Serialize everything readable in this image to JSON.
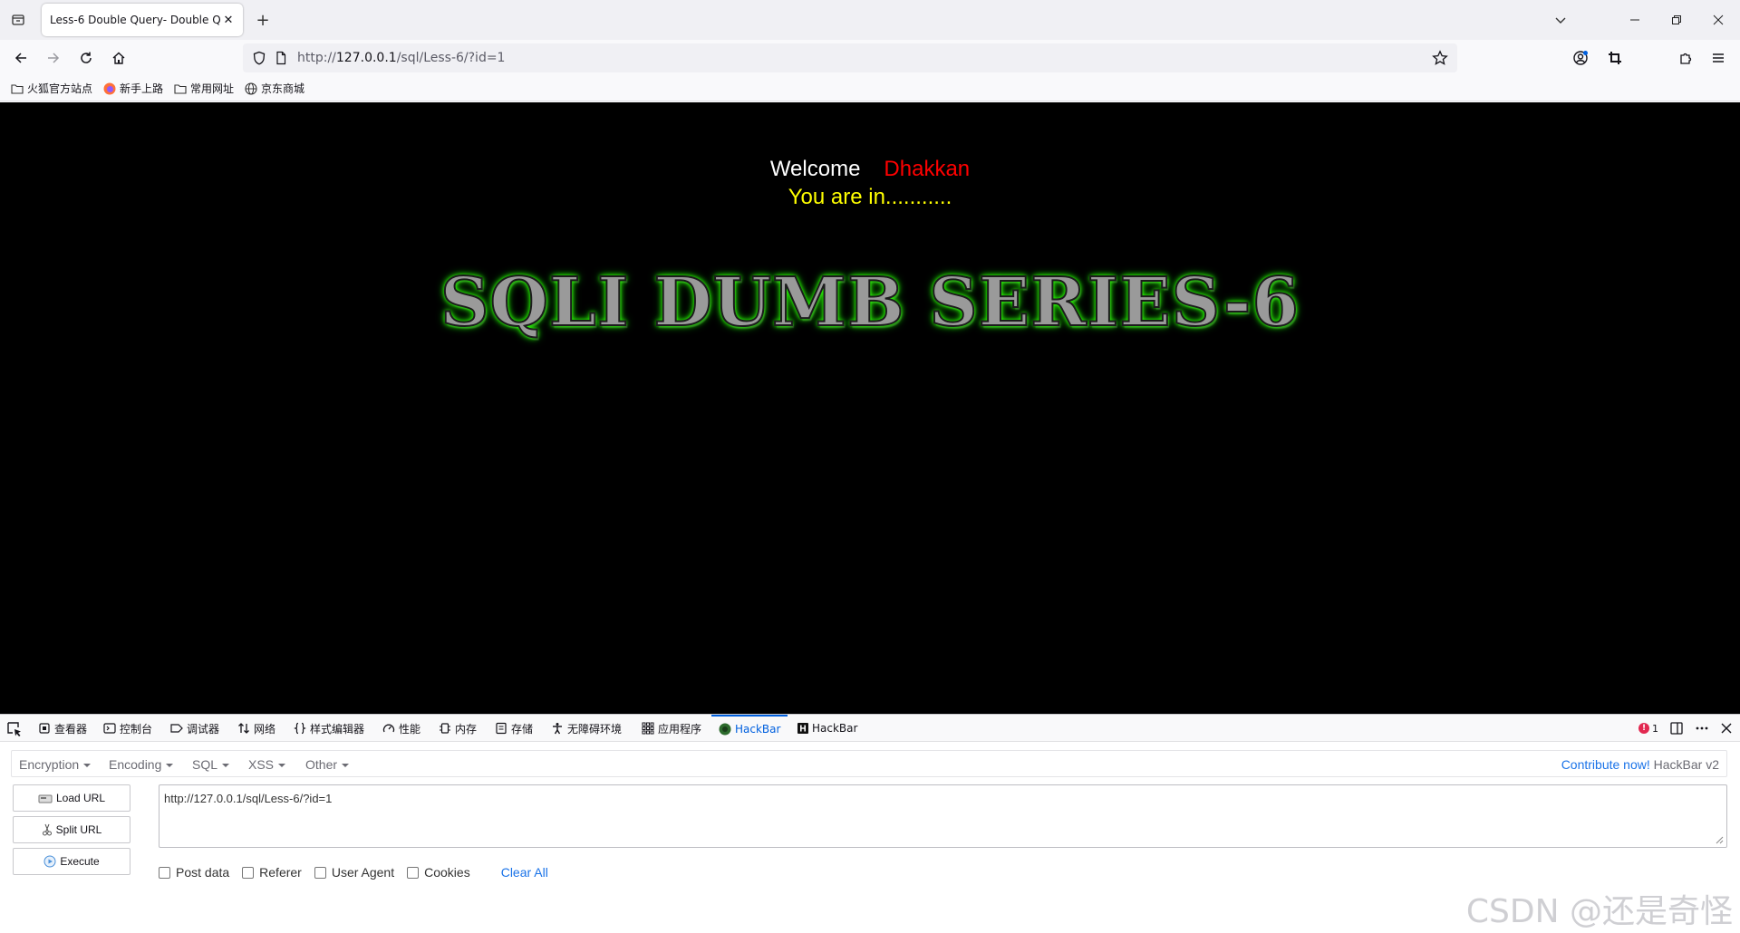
{
  "browser": {
    "tab_title": "Less-6 Double Query- Double Q",
    "tab_close": "✕",
    "new_tab": "+",
    "url_prefix": "http://",
    "url_host": "127.0.0.1",
    "url_path": "/sql/Less-6/?id=1",
    "bookmarks": [
      {
        "label": "火狐官方站点",
        "icon": "folder-icon"
      },
      {
        "label": "新手上路",
        "icon": "firefox-icon"
      },
      {
        "label": "常用网址",
        "icon": "folder-icon"
      },
      {
        "label": "京东商城",
        "icon": "globe-icon"
      }
    ]
  },
  "page": {
    "welcome": "Welcome",
    "user": "Dhakkan",
    "status": "You are in...........",
    "banner": "SQLI DUMB SERIES-6",
    "background": "#000000",
    "welcome_color": "#ffffff",
    "user_color": "#ff0000",
    "status_color": "#ffff00",
    "banner_glow": "#28ff00"
  },
  "devtools": {
    "tabs": [
      {
        "label": "查看器",
        "icon": "inspector-icon"
      },
      {
        "label": "控制台",
        "icon": "console-icon"
      },
      {
        "label": "调试器",
        "icon": "debugger-icon"
      },
      {
        "label": "网络",
        "icon": "network-icon"
      },
      {
        "label": "样式编辑器",
        "icon": "style-editor-icon"
      },
      {
        "label": "性能",
        "icon": "performance-icon"
      },
      {
        "label": "内存",
        "icon": "memory-icon"
      },
      {
        "label": "存储",
        "icon": "storage-icon"
      },
      {
        "label": "无障碍环境",
        "icon": "accessibility-icon"
      },
      {
        "label": "应用程序",
        "icon": "application-icon"
      },
      {
        "label": "HackBar",
        "icon": "hackbar-icon",
        "active": true
      },
      {
        "label": "HackBar",
        "icon": "hackbar-v1-icon"
      }
    ],
    "error_count": "1",
    "accent": "#0060df"
  },
  "hackbar": {
    "menus": [
      "Encryption",
      "Encoding",
      "SQL",
      "XSS",
      "Other"
    ],
    "contribute_link": "Contribute now!",
    "version": "HackBar v2",
    "buttons": [
      "Load URL",
      "Split URL",
      "Execute"
    ],
    "url_value": "http://127.0.0.1/sql/Less-6/?id=1",
    "options": [
      "Post data",
      "Referer",
      "User Agent",
      "Cookies"
    ],
    "clear_all": "Clear All",
    "link_color": "#1a73e8"
  },
  "watermark": "CSDN @还是奇怪"
}
